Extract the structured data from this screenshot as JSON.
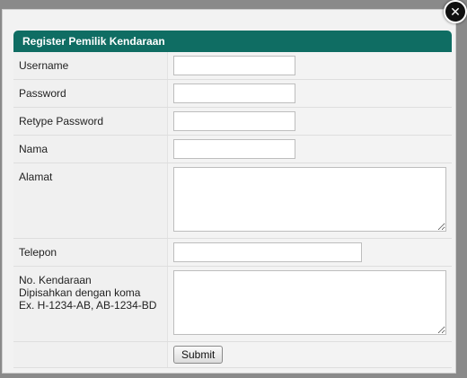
{
  "modal": {
    "close_icon": "close-icon",
    "title": "Register Pemilik Kendaraan"
  },
  "fields": {
    "username": {
      "label": "Username",
      "value": ""
    },
    "password": {
      "label": "Password",
      "value": ""
    },
    "retype_password": {
      "label": "Retype Password",
      "value": ""
    },
    "nama": {
      "label": "Nama",
      "value": ""
    },
    "alamat": {
      "label": "Alamat",
      "value": ""
    },
    "telepon": {
      "label": "Telepon",
      "value": ""
    },
    "kendaraan": {
      "label_line1": "No. Kendaraan",
      "label_line2": "Dipisahkan dengan koma",
      "label_line3": "Ex. H-1234-AB, AB-1234-BD",
      "value": ""
    }
  },
  "actions": {
    "submit_label": "Submit"
  },
  "colors": {
    "header_bg": "#0f6d63",
    "overlay": "#8a8a8a"
  }
}
